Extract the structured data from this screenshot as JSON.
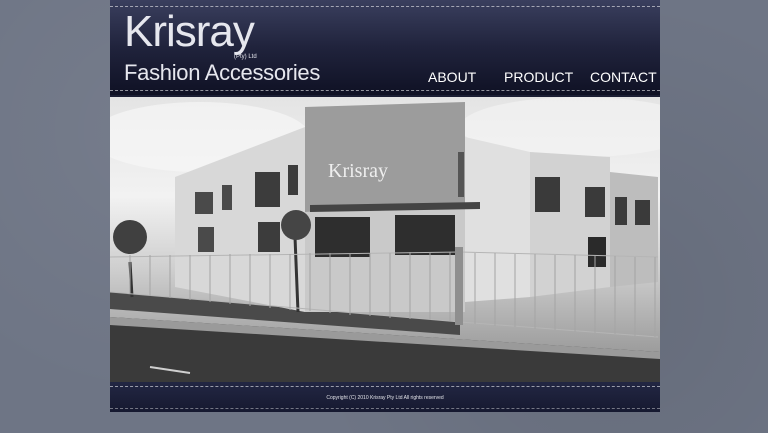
{
  "brand": {
    "name": "Krisray",
    "pty": "(Pty) Ltd",
    "tagline": "Fashion Accessories",
    "building_sign": "Krisray"
  },
  "nav": {
    "items": [
      {
        "label": "ABOUT"
      },
      {
        "label": "PRODUCT"
      },
      {
        "label": "CONTACT"
      }
    ]
  },
  "footer": {
    "copyright": "Copyright (C) 2010 Krisray Pty Ltd All rights reserved"
  },
  "colors": {
    "background": "#6e7585",
    "header_dark": "#1b1e33",
    "text_light": "#ffffff"
  }
}
